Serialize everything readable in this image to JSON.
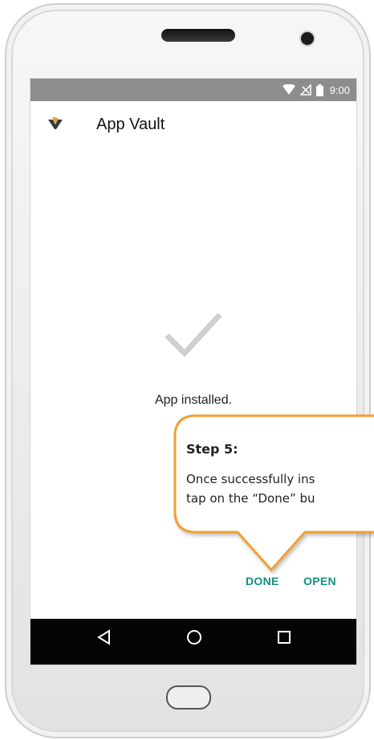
{
  "status_bar": {
    "time": "9:00",
    "icons": [
      "wifi-icon",
      "no-signal-icon",
      "battery-icon"
    ]
  },
  "app_bar": {
    "logo": "app-vault-logo",
    "title": "App Vault"
  },
  "content": {
    "icon": "checkmark-icon",
    "message": "App installed."
  },
  "actions": {
    "done_label": "DONE",
    "open_label": "OPEN"
  },
  "nav_bar": {
    "icons": [
      "back-icon",
      "home-icon",
      "recents-icon"
    ]
  },
  "callout": {
    "step": "Step 5:",
    "line1": "Once successfully ins",
    "line2": "tap on the “Done” bu"
  },
  "colors": {
    "accent": "#13917f",
    "callout_border": "#f0a030",
    "status_bar": "#8d8d8d",
    "nav_bar": "#050505"
  }
}
